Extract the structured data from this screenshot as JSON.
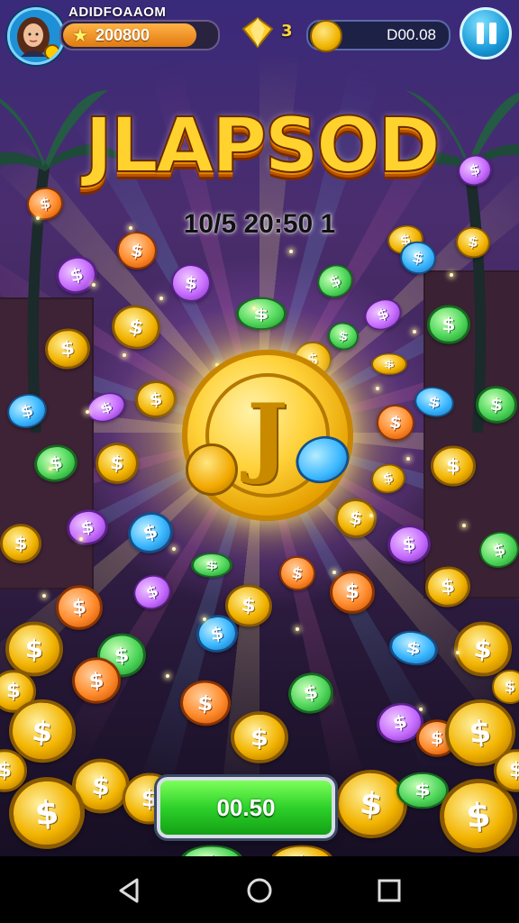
{
  "hud": {
    "player_name": "ADIDFOAAOM",
    "gold_value": "200800",
    "gem_count": "3",
    "coin_balance": "D00.08"
  },
  "title": {
    "main": "JLAPSOD",
    "sub": "10/5 20:50 1"
  },
  "collect_button": {
    "label": "00.50"
  },
  "coin_symbol": "$",
  "colors": {
    "gold": "#ffd23a",
    "green": "#4ed65a",
    "blue": "#38b6ff",
    "purple": "#c66cff",
    "orange": "#ff8a2a",
    "button_green": "#2ed12a",
    "pause_blue": "#1a9ad8"
  },
  "icons": [
    "player-avatar",
    "star-icon",
    "gem-icon",
    "coin-icon",
    "pause-icon",
    "back-icon",
    "home-icon",
    "recents-icon"
  ]
}
